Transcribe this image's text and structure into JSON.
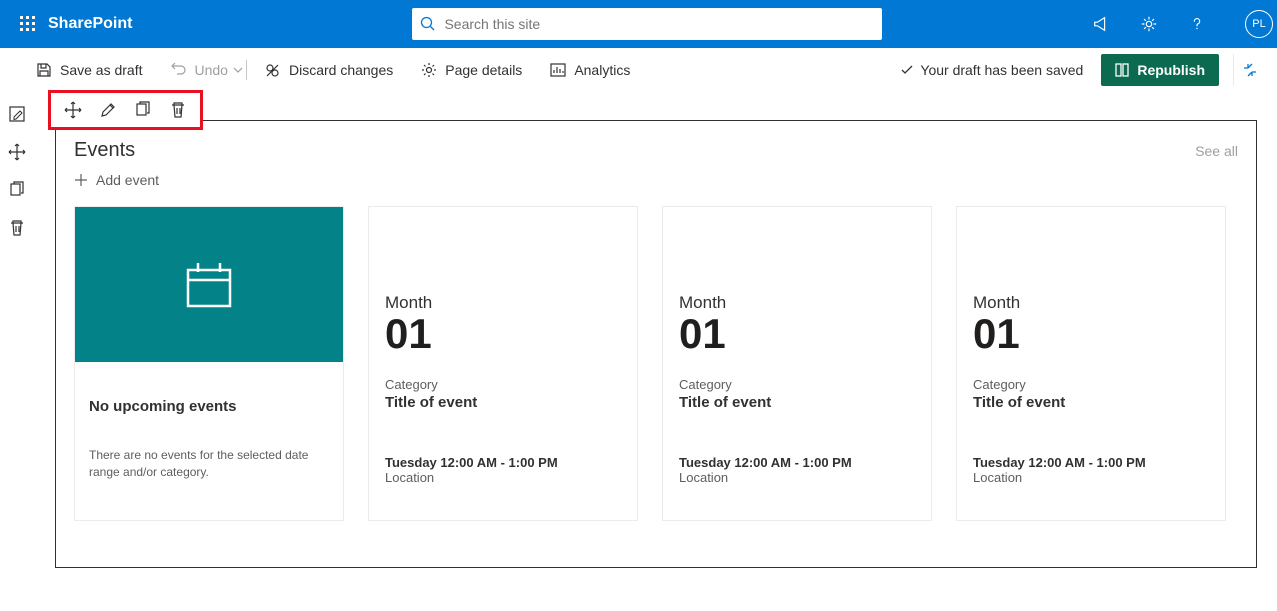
{
  "header": {
    "brand": "SharePoint",
    "search_placeholder": "Search this site",
    "avatar_initials": "PL"
  },
  "cmdbar": {
    "save_draft": "Save as draft",
    "undo": "Undo",
    "discard": "Discard changes",
    "page_details": "Page details",
    "analytics": "Analytics",
    "draft_saved": "Your draft has been saved",
    "republish": "Republish"
  },
  "webpart": {
    "title": "Events",
    "see_all": "See all",
    "add_event": "Add event",
    "empty_card": {
      "title": "No upcoming events",
      "message": "There are no events for the selected date range and/or category."
    },
    "events": [
      {
        "month": "Month",
        "day": "01",
        "category": "Category",
        "title": "Title of event",
        "time": "Tuesday 12:00 AM - 1:00 PM",
        "location": "Location"
      },
      {
        "month": "Month",
        "day": "01",
        "category": "Category",
        "title": "Title of event",
        "time": "Tuesday 12:00 AM - 1:00 PM",
        "location": "Location"
      },
      {
        "month": "Month",
        "day": "01",
        "category": "Category",
        "title": "Title of event",
        "time": "Tuesday 12:00 AM - 1:00 PM",
        "location": "Location"
      }
    ]
  }
}
